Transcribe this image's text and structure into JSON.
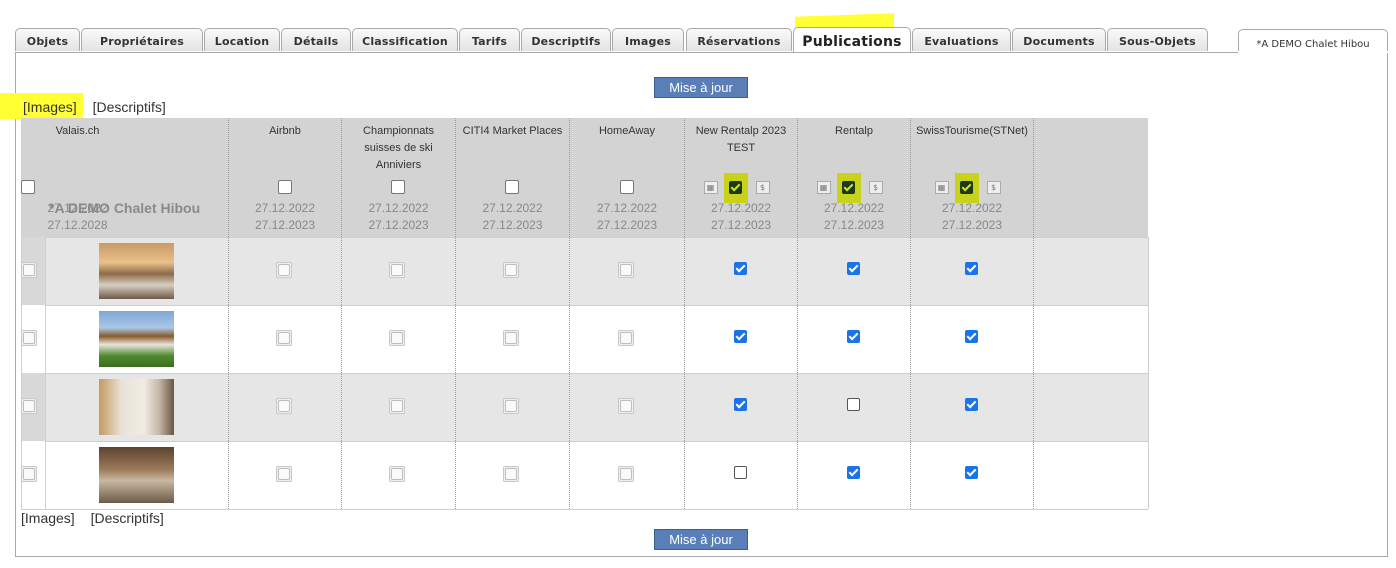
{
  "tabs": [
    "Objets",
    "Propriétaires",
    "Location",
    "Détails",
    "Classification",
    "Tarifs",
    "Descriptifs",
    "Images",
    "Réservations",
    "Publications",
    "Evaluations",
    "Documents",
    "Sous-Objets"
  ],
  "active_tab": "Publications",
  "object_tab": "*A DEMO Chalet Hibou",
  "update_button": "Mise à jour",
  "links": {
    "images": "[Images]",
    "descriptifs": "[Descriptifs]"
  },
  "object_name": "*A DEMO Chalet Hibou",
  "channels": [
    {
      "name_lines": [
        "Airbnb"
      ],
      "dates": [
        "27.12.2022",
        "27.12.2023"
      ],
      "enabled": false
    },
    {
      "name_lines": [
        "Championnats",
        "suisses de ski",
        "Anniviers"
      ],
      "dates": [
        "27.12.2022",
        "27.12.2023"
      ],
      "enabled": false
    },
    {
      "name_lines": [
        "CITI4 Market Places"
      ],
      "dates": [
        "27.12.2022",
        "27.12.2023"
      ],
      "enabled": false
    },
    {
      "name_lines": [
        "HomeAway"
      ],
      "dates": [
        "27.12.2022",
        "27.12.2023"
      ],
      "enabled": false
    },
    {
      "name_lines": [
        "New Rentalp 2023",
        "TEST"
      ],
      "dates": [
        "27.12.2022",
        "27.12.2023"
      ],
      "enabled": true
    },
    {
      "name_lines": [
        "Rentalp"
      ],
      "dates": [
        "27.12.2022",
        "27.12.2023"
      ],
      "enabled": true
    },
    {
      "name_lines": [
        "SwissTourisme(STNet)"
      ],
      "dates": [
        "27.12.2022",
        "27.12.2023"
      ],
      "enabled": true
    },
    {
      "name_lines": [
        "Valais.ch"
      ],
      "dates": [
        "27.12.2022",
        "27.12.2028"
      ],
      "enabled": false
    }
  ],
  "image_rows": [
    {
      "image": "bedroom-photo",
      "checks": [
        "disabled",
        "disabled",
        "disabled",
        "disabled",
        "checked",
        "checked",
        "checked",
        "disabled"
      ]
    },
    {
      "image": "chalet-exterior-photo",
      "checks": [
        "disabled",
        "disabled",
        "disabled",
        "disabled",
        "checked",
        "checked",
        "checked",
        "disabled"
      ]
    },
    {
      "image": "bedroom-2-photo",
      "checks": [
        "disabled",
        "disabled",
        "disabled",
        "disabled",
        "checked",
        "unchecked",
        "checked",
        "disabled"
      ]
    },
    {
      "image": "living-room-photo",
      "checks": [
        "disabled",
        "disabled",
        "disabled",
        "disabled",
        "unchecked",
        "checked",
        "checked",
        "disabled"
      ]
    }
  ],
  "colors": {
    "accent_button": "#5a7fb8",
    "highlight": "#ffff33",
    "checkbox_on": "#1a73e8",
    "header_bg": "#d3d3d3"
  }
}
